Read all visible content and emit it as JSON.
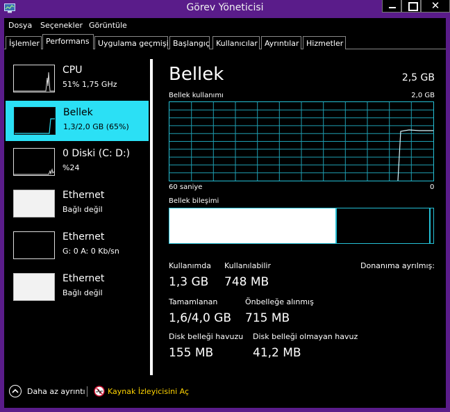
{
  "window": {
    "title": "Görev Yöneticisi",
    "close_glyph": "✕"
  },
  "menu": [
    "Dosya",
    "Seçenekler",
    "Görüntüle"
  ],
  "tabs": [
    "İşlemler",
    "Performans",
    "Uygulama geçmişi",
    "Başlangıç",
    "Kullanıcılar",
    "Ayrıntılar",
    "Hizmetler"
  ],
  "active_tab": "Performans",
  "sidebar": [
    {
      "name": "CPU",
      "sub": "51% 1,75 GHz"
    },
    {
      "name": "Bellek",
      "sub": "1,3/2,0 GB (65%)"
    },
    {
      "name": "0 Diski (C: D:)",
      "sub": "%24"
    },
    {
      "name": "Ethernet",
      "sub": "Bağlı değil"
    },
    {
      "name": "Ethernet",
      "sub": "G: 0 A: 0 Kb/sn"
    },
    {
      "name": "Ethernet",
      "sub": "Bağlı değil"
    }
  ],
  "main": {
    "title": "Bellek",
    "total": "2,5 GB",
    "usage_label": "Bellek kullanımı",
    "usage_max": "2,0 GB",
    "graph_left": "60 saniye",
    "graph_right": "0",
    "composition_label": "Bellek bileşimi",
    "stats": {
      "in_use_label": "Kullanımda",
      "in_use": "1,3 GB",
      "available_label": "Kullanılabilir",
      "available": "748 MB",
      "reserved_label": "Donanıma ayrılmış:",
      "committed_label": "Tamamlanan",
      "committed": "1,6/4,0 GB",
      "cached_label": "Önbelleğe alınmış",
      "cached": "715 MB",
      "paged_label": "Disk belleği havuzu",
      "paged": "155 MB",
      "nonpaged_label": "Disk belleği olmayan havuz",
      "nonpaged": "41,2 MB"
    }
  },
  "footer": {
    "fewer_details": "Daha az ayrıntı",
    "resource_monitor": "Kaynak İzleyicisini Aç"
  },
  "colors": {
    "accent": "#2be0f5",
    "titlebar": "#5a1c8a",
    "link": "#ffd400"
  }
}
